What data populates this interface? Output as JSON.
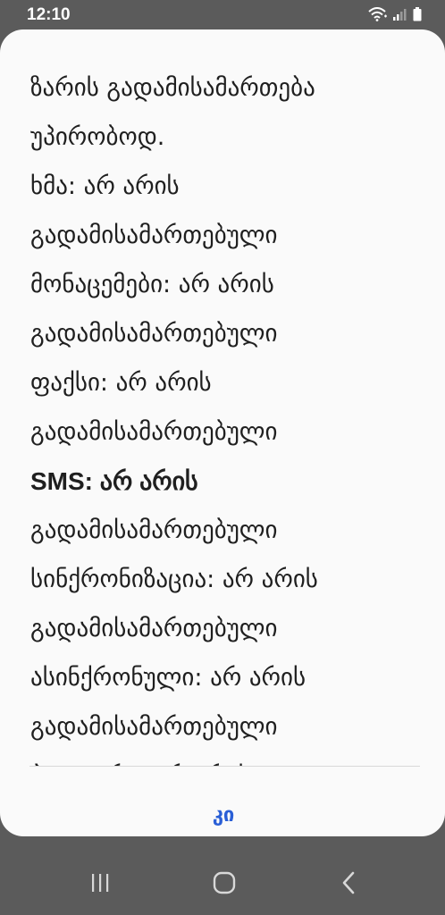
{
  "status_bar": {
    "time": "12:10",
    "icons": [
      "wifi-icon",
      "signal-icon",
      "battery-icon"
    ]
  },
  "dialog": {
    "lines": [
      "ზარის გადამისამართება",
      "უპირობოდ.",
      "ხმა: არ არის",
      "გადამისამართებული",
      "მონაცემები: არ არის",
      "გადამისამართებული",
      "ფაქსი: არ არის",
      "გადამისამართებული",
      "SMS: არ არის",
      "გადამისამართებული",
      "სინქრონიზაცია: არ არის",
      "გადამისამართებული",
      "ასინქრონული: არ არის",
      "გადამისამართებული",
      "პაკეტური: არ არის"
    ],
    "ok_label": "კი"
  },
  "nav_bar": {
    "icons": [
      "recent-apps-icon",
      "home-icon",
      "back-icon"
    ]
  },
  "colors": {
    "background": "#5b5b5b",
    "dialog": "#fafafa",
    "accent": "#2a5fd6",
    "text": "#1f1f1f"
  }
}
